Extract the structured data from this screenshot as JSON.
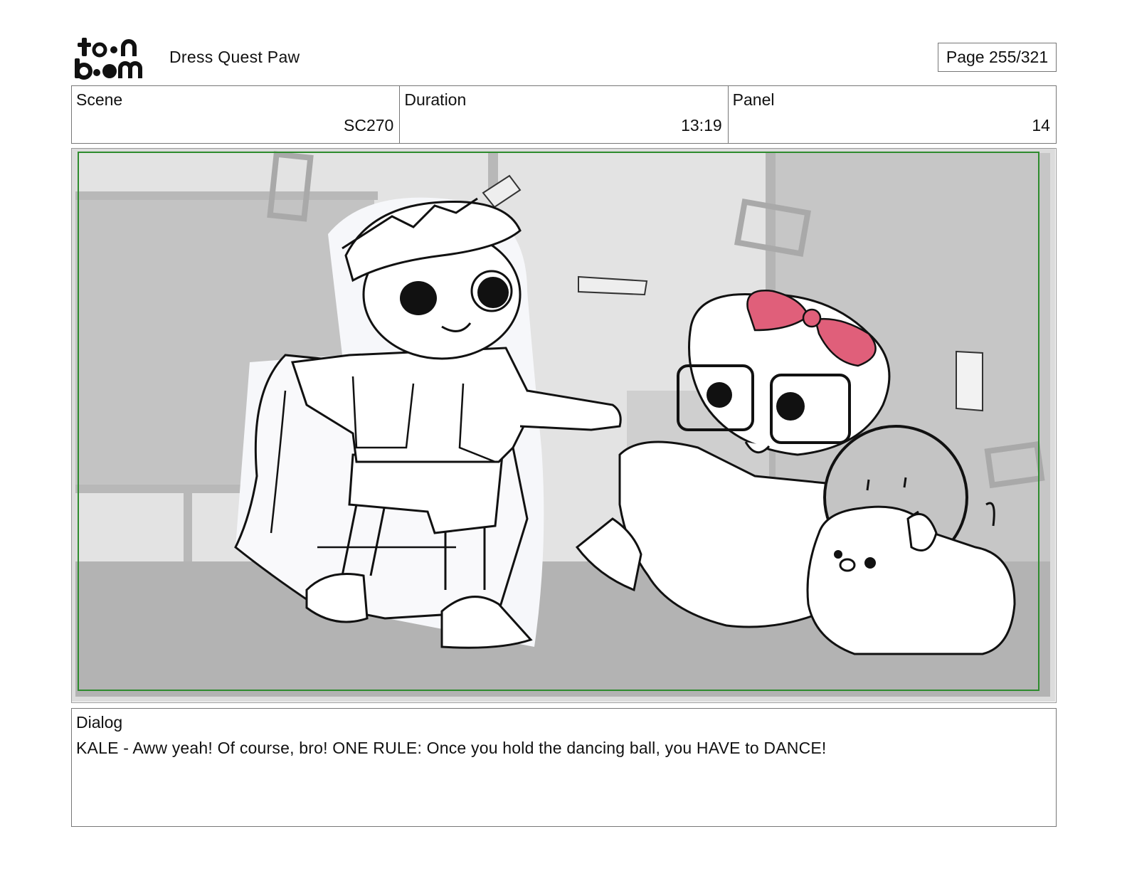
{
  "header": {
    "logo_text": "toon boom",
    "project_title": "Dress Quest Paw",
    "page_indicator": "Page 255/321"
  },
  "info": {
    "scene_label": "Scene",
    "scene_value": "SC270",
    "duration_label": "Duration",
    "duration_value": "13:19",
    "panel_label": "Panel",
    "panel_value": "14"
  },
  "panel_image": {
    "safe_frame_color": "#2e8b2e",
    "bow_color": "#e05f7a"
  },
  "dialog": {
    "label": "Dialog",
    "text": "KALE - Aww yeah! Of course, bro! ONE RULE: Once you hold the dancing ball, you HAVE to DANCE!"
  }
}
